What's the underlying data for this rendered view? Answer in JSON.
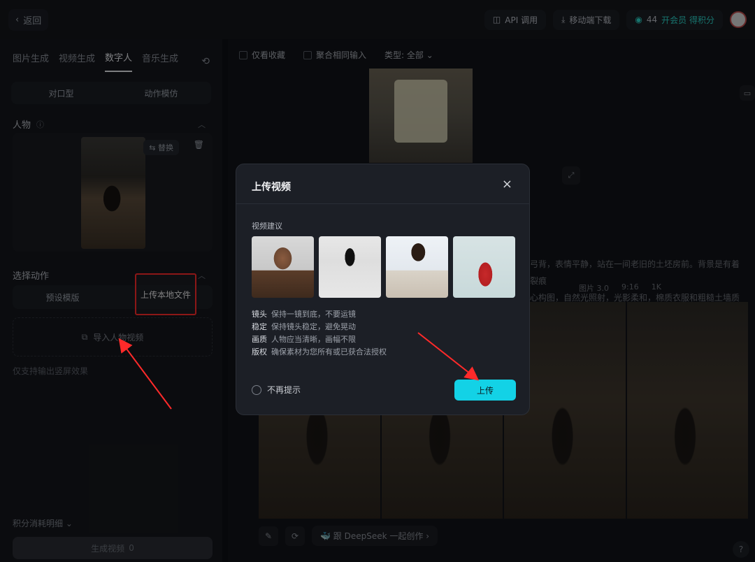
{
  "topbar": {
    "back_label": "返回",
    "api_label": "API 调用",
    "mobile_label": "移动端下载",
    "points_value": "44",
    "member_label": "开会员 得积分"
  },
  "left": {
    "tabs": [
      "图片生成",
      "视频生成",
      "数字人",
      "音乐生成"
    ],
    "active_tab": "数字人",
    "mode_segment": [
      "对口型",
      "动作模仿"
    ],
    "person_title": "人物",
    "replace_label": "替换",
    "action_title": "选择动作",
    "action_segment": [
      "预设模版",
      "上传本地文件"
    ],
    "import_label": "导入人物视频",
    "hint": "仅支持输出竖屏效果",
    "cost_label": "积分消耗明细",
    "generate_label": "生成视频",
    "generate_cost": "0"
  },
  "main": {
    "filters": [
      "仅看收藏",
      "聚合相同输入",
      "类型: 全部"
    ],
    "bg_text": "弓背，表情平静，站在一间老旧的土坯房前。背景是有着裂痕\n心构图，自然光照射，光影柔和，棉质衣服和粗糙土墙质感分\n晰，16K。",
    "tags": [
      "图片 3.0",
      "9:16",
      "1K"
    ],
    "deepseek_label": "跟 DeepSeek 一起创作"
  },
  "modal": {
    "title": "上传视频",
    "suggest_label": "视频建议",
    "tips": [
      {
        "k": "镜头",
        "v": "保持一镜到底，不要运镜"
      },
      {
        "k": "稳定",
        "v": "保持镜头稳定，避免晃动"
      },
      {
        "k": "画质",
        "v": "人物应当清晰，画幅不限"
      },
      {
        "k": "版权",
        "v": "确保素材为您所有或已获合法授权"
      }
    ],
    "dont_remind_label": "不再提示",
    "upload_label": "上传"
  },
  "colors": {
    "accent_cyan": "#13d2e6",
    "annotation_red": "#ff2a2a"
  }
}
